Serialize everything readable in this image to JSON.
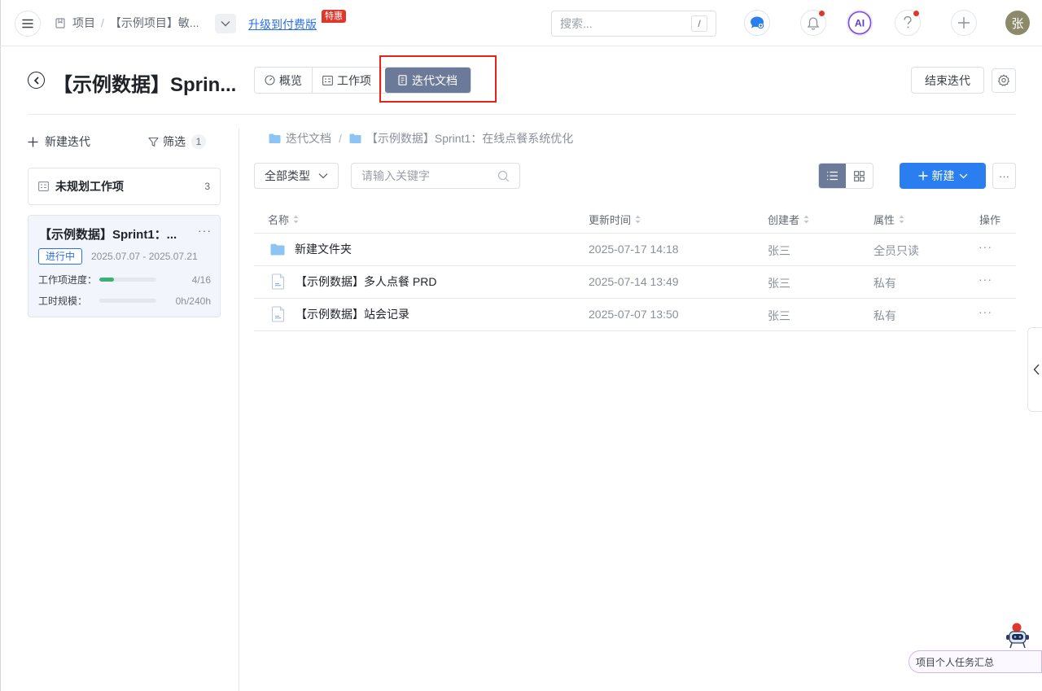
{
  "topbar": {
    "breadcrumb": {
      "project_label": "项目",
      "separator": "/",
      "current_project": "【示例项目】敏..."
    },
    "upgrade_link": "升级到付费版",
    "promo_badge": "特惠",
    "search": {
      "placeholder": "搜索...",
      "shortcut": "/"
    },
    "avatar_initial": "张"
  },
  "header": {
    "title": "【示例数据】Sprin...",
    "tabs": [
      {
        "label": "概览",
        "icon": "dashboard-icon",
        "active": false
      },
      {
        "label": "工作项",
        "icon": "list-board-icon",
        "active": false
      },
      {
        "label": "迭代文档",
        "icon": "document-icon",
        "active": true
      }
    ],
    "end_button": "结束迭代"
  },
  "sidebar": {
    "new_iteration": "新建迭代",
    "filter": {
      "label": "筛选",
      "count": "1"
    },
    "unplanned": {
      "label": "未规划工作项",
      "count": "3"
    },
    "sprint": {
      "title": "【示例数据】Sprint1：...",
      "status": "进行中",
      "date_range": "2025.07.07 - 2025.07.21",
      "progress": {
        "label": "工作项进度：",
        "value": "4/16",
        "fraction": 0.25
      },
      "workload": {
        "label": "工时规模：",
        "value": "0h/240h",
        "fraction": 0
      }
    }
  },
  "main": {
    "breadcrumb": {
      "root": "迭代文档",
      "separator": "/",
      "current": "【示例数据】Sprint1：在线点餐系统优化"
    },
    "type_select": "全部类型",
    "keyword_placeholder": "请输入关键字",
    "create_button": "新建",
    "table": {
      "columns": {
        "name": "名称",
        "updated": "更新时间",
        "creator": "创建者",
        "property": "属性",
        "action": "操作"
      },
      "rows": [
        {
          "name": "新建文件夹",
          "type": "folder",
          "updated": "2025-07-17 14:18",
          "creator": "张三",
          "property": "全员只读"
        },
        {
          "name": "【示例数据】多人点餐 PRD",
          "type": "document",
          "updated": "2025-07-14 13:49",
          "creator": "张三",
          "property": "私有"
        },
        {
          "name": "【示例数据】站会记录",
          "type": "document",
          "updated": "2025-07-07 13:50",
          "creator": "张三",
          "property": "私有"
        }
      ]
    }
  },
  "floating": {
    "summary_label": "项目个人任务汇总"
  },
  "colors": {
    "accent": "#2a7ef0",
    "active_tab": "#6c7a99",
    "highlight": "#e8231a",
    "progress": "#3bb273",
    "badge_red": "#e0372c"
  }
}
